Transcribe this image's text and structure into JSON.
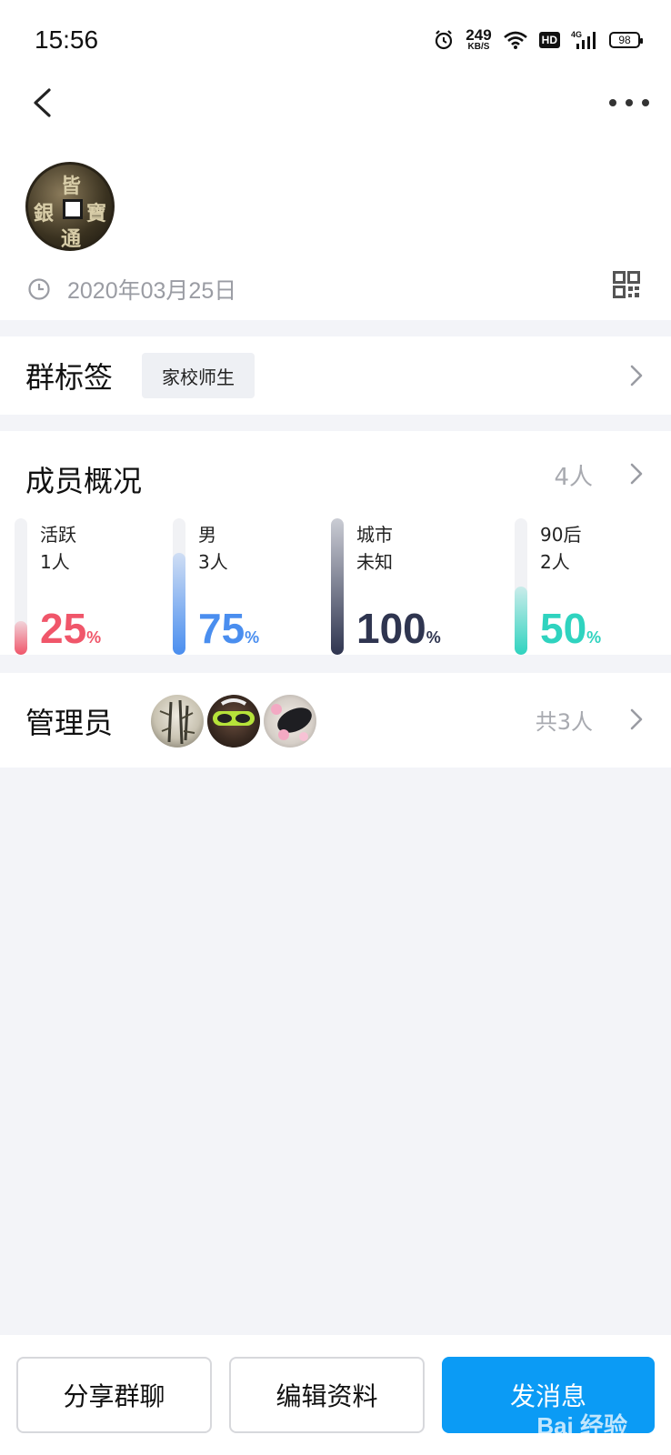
{
  "status_bar": {
    "time": "15:56",
    "net_speed": "249",
    "net_unit": "KB/S",
    "hd": "HD",
    "network": "4G",
    "battery": "98",
    "icons": [
      "alarm-icon",
      "wifi-icon",
      "signal-icon",
      "battery-icon"
    ]
  },
  "header": {
    "icons": [
      "chevron-left-icon",
      "more-dots-icon",
      "clock-icon",
      "qr-code-icon"
    ],
    "avatar_glyphs": [
      "皆",
      "寶",
      "通",
      "銀"
    ],
    "created_date": "2020年03月25日"
  },
  "group_tags": {
    "title": "群标签",
    "tag": "家校师生"
  },
  "members": {
    "title": "成员概况",
    "count": "4人",
    "stats": [
      {
        "label": "活跃",
        "sub": "1人",
        "percent": 25,
        "pct_text": "25",
        "unit": "%",
        "color": "#f0566a"
      },
      {
        "label": "男",
        "sub": "3人",
        "percent": 75,
        "pct_text": "75",
        "unit": "%",
        "color": "#4a8eef"
      },
      {
        "label": "城市",
        "sub": "未知",
        "percent": 100,
        "pct_text": "100",
        "unit": "%",
        "color": "#2f3550"
      },
      {
        "label": "90后",
        "sub": "2人",
        "percent": 50,
        "pct_text": "50",
        "unit": "%",
        "color": "#2fd3bf"
      }
    ]
  },
  "admins": {
    "title": "管理员",
    "count": "共3人"
  },
  "bottom_actions": {
    "share": "分享群聊",
    "edit": "编辑资料",
    "send": "发消息",
    "watermark": "Bai 经验"
  },
  "colors": {
    "primary": "#0b9bf5",
    "page_bg": "#f3f4f8"
  }
}
